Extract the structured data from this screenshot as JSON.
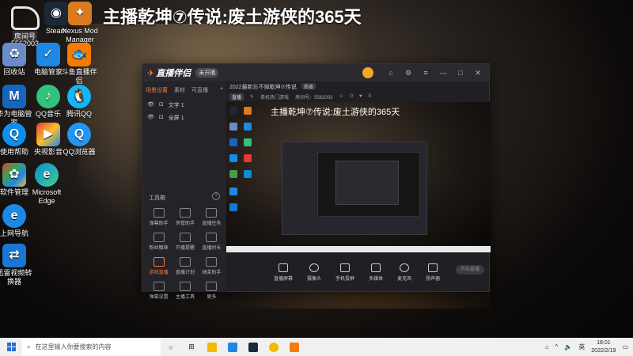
{
  "overlay": {
    "title": "主播乾坤⑦传说:废土游侠的365天"
  },
  "logo": {
    "tag": "房间号",
    "number": "5562003"
  },
  "desktop_icons": [
    {
      "label": "Steam",
      "icon": "steam-icon",
      "color": "#1b2838"
    },
    {
      "label": "Nexus Mod Manager",
      "icon": "nexus-icon",
      "color": "#d97b1f"
    },
    {
      "label": "回收站",
      "icon": "recycle-bin-icon",
      "color": "#6a8cc9"
    },
    {
      "label": "电脑管家",
      "icon": "pc-manager-icon",
      "color": "#1e88e5"
    },
    {
      "label": "斗鱼直播伴侣",
      "icon": "douyu-icon",
      "color": "#f57c00"
    },
    {
      "label": "华为电脑管家",
      "icon": "huawei-icon",
      "color": "#1565c0"
    },
    {
      "label": "QQ音乐",
      "icon": "qq-music-icon",
      "color": "#31c27c"
    },
    {
      "label": "腾讯QQ",
      "icon": "qq-icon",
      "color": "#12b7f5"
    },
    {
      "label": "使用帮助",
      "icon": "help-icon",
      "color": "#0d8ff0"
    },
    {
      "label": "央视影音",
      "icon": "cctv-icon",
      "color": "#e53935"
    },
    {
      "label": "QQ浏览器",
      "icon": "qq-browser-icon",
      "color": "#2196f3"
    },
    {
      "label": "软件管理",
      "icon": "software-manager-icon",
      "color": "#43a047"
    },
    {
      "label": "Microsoft Edge",
      "icon": "edge-icon",
      "color": "#0c8bd6"
    },
    {
      "label": "上网导航",
      "icon": "ie-icon",
      "color": "#1e88e5"
    },
    {
      "label": "迅雷视频转换器",
      "icon": "converter-icon",
      "color": "#1976d2"
    }
  ],
  "app": {
    "logo": "直播伴侣",
    "badge": "未开播",
    "tabs": [
      "场景设置",
      "素材",
      "可直播"
    ],
    "scenes": [
      "文字 1",
      "全屏 1"
    ],
    "tools_title": "工具箱",
    "tools": [
      "弹幕助手",
      "房管助手",
      "直播任务",
      "粉丝徽章",
      "开播提醒",
      "直播时长",
      "游戏直播",
      "直播计划",
      "抽奖助手",
      "弹幕设置",
      "主播工具",
      "更多"
    ],
    "stream_title": "2022最新忘不掉乾坤⑦传说",
    "stream_tag": "热搜",
    "info_room": "房间号：5562003",
    "info_live": "直播",
    "info_category": "单机热门游戏",
    "info_viewers": "0",
    "info_fans": "0",
    "preview_title": "主播乾坤⑦传说:废土游侠的365天",
    "controls": [
      "直播屏幕",
      "摄像头",
      "手机投屏",
      "多媒体",
      "麦克风",
      "扬声器"
    ],
    "go_live": "开始直播"
  },
  "taskbar": {
    "search_placeholder": "在这里输入你要搜索的内容",
    "time": "18:01",
    "date": "2022/2/19"
  }
}
